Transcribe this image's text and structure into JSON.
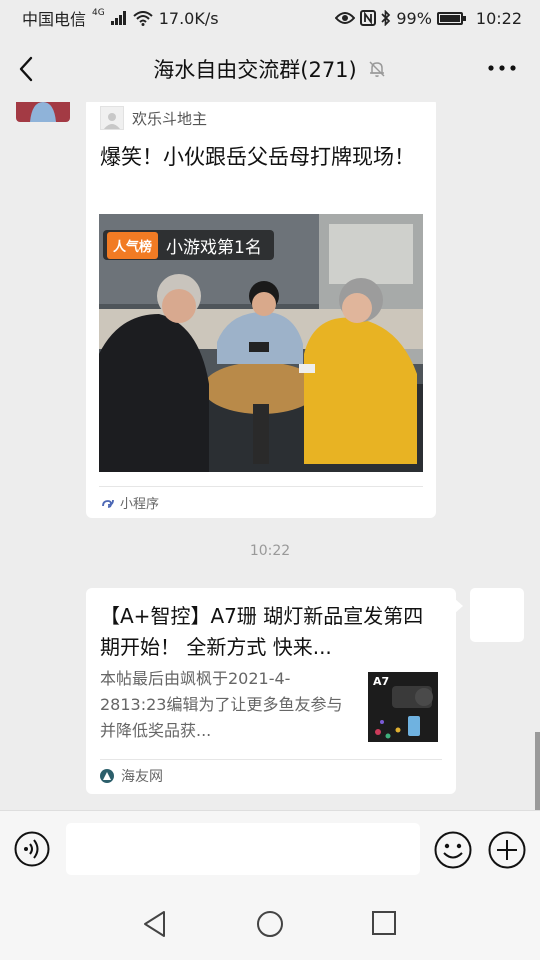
{
  "status_bar": {
    "carrier": "中国电信",
    "network": "4G",
    "speed": "17.0K/s",
    "battery": "99%",
    "battery_level": 0.99,
    "time": "10:22",
    "icons": [
      "signal-icon",
      "wifi-icon",
      "eye-icon",
      "nfc-icon",
      "bluetooth-icon",
      "battery-icon"
    ]
  },
  "header": {
    "title": "海水自由交流群(271)",
    "icons": [
      "back-arrow-icon",
      "mute-bell-icon",
      "more-dots-icon"
    ]
  },
  "messages": [
    {
      "type": "mini_program_card",
      "source_name": "欢乐斗地主",
      "title": "爆笑！小伙跟岳父岳母打牌现场！",
      "badge_tag": "人气榜",
      "badge_text": "小游戏第1名",
      "footer_label": "小程序"
    },
    {
      "type": "timestamp",
      "text": "10:22"
    },
    {
      "type": "link_card",
      "title": "【A+智控】A7珊 瑚灯新品宣发第四期开始！ 全新方式  快来...",
      "description": "本帖最后由飒枫于2021-4-2813:23编辑为了让更多鱼友参与并降低奖品获...",
      "thumb_text": "A7",
      "footer_label": "海友网"
    }
  ],
  "input_bar": {
    "value": "",
    "icons": [
      "voice-icon",
      "emoji-icon",
      "plus-icon"
    ]
  },
  "nav_bar": {
    "icons": [
      "nav-back-icon",
      "nav-home-icon",
      "nav-recent-icon"
    ]
  },
  "colors": {
    "background": "#ededed",
    "card": "#ffffff",
    "badge_orange": "#f17b24",
    "timestamp": "#999999"
  }
}
